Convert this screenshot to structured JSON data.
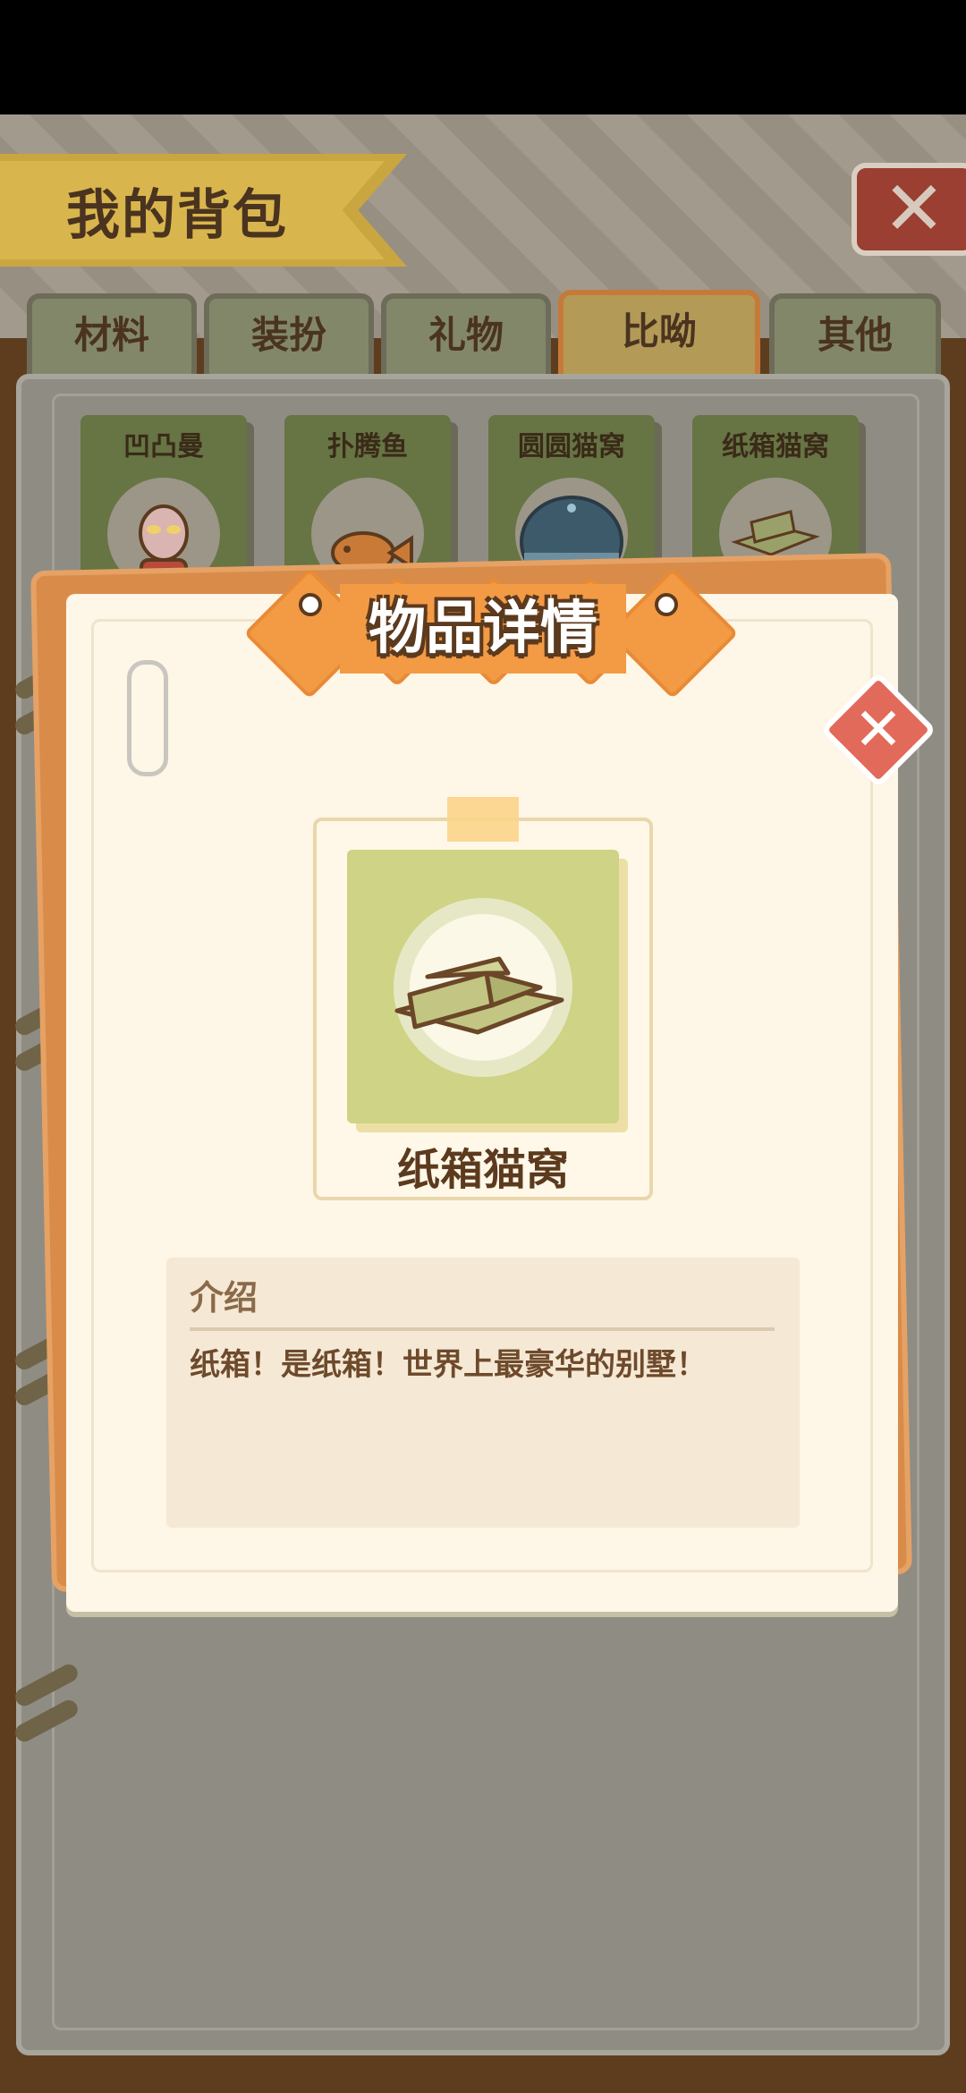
{
  "window": {
    "title": "我的背包"
  },
  "tabs": [
    {
      "label": "材料",
      "active": false
    },
    {
      "label": "装扮",
      "active": false
    },
    {
      "label": "礼物",
      "active": false
    },
    {
      "label": "比呦",
      "active": true
    },
    {
      "label": "其他",
      "active": false
    }
  ],
  "items": [
    {
      "name": "凹凸曼",
      "icon": "ultraman-toy-icon"
    },
    {
      "name": "扑腾鱼",
      "icon": "fish-toy-icon"
    },
    {
      "name": "圆圆猫窝",
      "icon": "round-cat-bed-icon"
    },
    {
      "name": "纸箱猫窝",
      "icon": "cardboard-box-icon"
    }
  ],
  "modal": {
    "title": "物品详情",
    "item_name": "纸箱猫窝",
    "item_icon": "cardboard-box-icon",
    "intro_label": "介绍",
    "intro_text": "纸箱！是纸箱！世界上最豪华的别墅！"
  },
  "colors": {
    "accent_orange": "#f39a45",
    "item_green": "#cfd385",
    "close_red": "#e26a5a",
    "text_brown": "#5c3a1e"
  }
}
